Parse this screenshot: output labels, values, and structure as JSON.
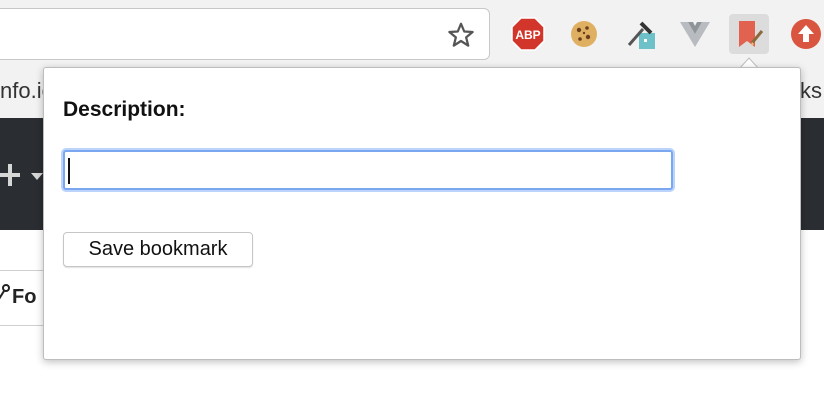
{
  "browser": {
    "address_value": "",
    "bookmark_star": "star-icon",
    "extensions": [
      {
        "name": "adblock-plus",
        "label": "ABP",
        "color": "#d2362a"
      },
      {
        "name": "cookie",
        "color": "#d7a24b"
      },
      {
        "name": "eyedropper",
        "color": "#6ec1c8"
      },
      {
        "name": "vue-devtools",
        "color": "#9aa0a6"
      },
      {
        "name": "bookmark-extension",
        "color": "#e0624f"
      },
      {
        "name": "upload",
        "color": "#d9553f"
      }
    ]
  },
  "background_page": {
    "bookmarks_left_fragment": "nfo.io",
    "bookmarks_right_fragment": "ks",
    "button_fragment": "Fo"
  },
  "popup": {
    "label": "Description:",
    "input_value": "",
    "save_label": "Save bookmark"
  },
  "colors": {
    "focus_ring": "#7aa7f0",
    "dark_band": "#2a2d31"
  }
}
